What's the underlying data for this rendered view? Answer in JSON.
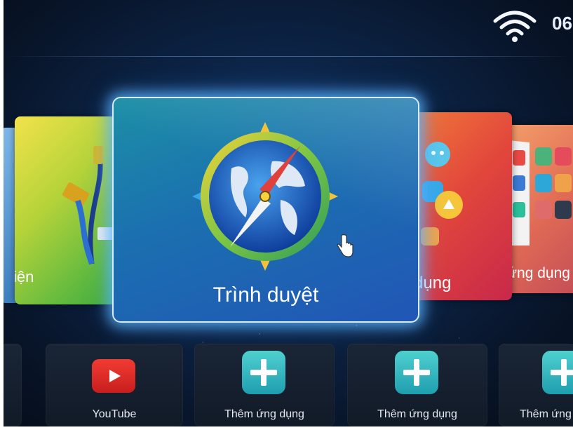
{
  "status_bar": {
    "wifi_icon": "wifi-icon",
    "time": "06"
  },
  "carousel": {
    "items": [
      {
        "label": "iện",
        "icon": "cable-hdmi-icon"
      },
      {
        "label": "Trình duyệt",
        "icon": "compass-browser-icon",
        "focused": true
      },
      {
        "label": "dụng",
        "icon": "apps-cluster-icon"
      },
      {
        "label": "ứng dụng",
        "icon": "app-grid-icon"
      }
    ]
  },
  "bottom_row": {
    "items": [
      {
        "label": "YouTube",
        "icon": "youtube-icon"
      },
      {
        "label": "Thêm ứng dụng",
        "icon": "add-app-icon"
      },
      {
        "label": "Thêm ứng dụng",
        "icon": "add-app-icon"
      },
      {
        "label": "Thêm ứng",
        "icon": "add-app-icon"
      }
    ]
  },
  "colors": {
    "focus_glow": "#5ab4ff",
    "youtube_red": "#e62b25",
    "add_teal": "#2fb6c0"
  }
}
